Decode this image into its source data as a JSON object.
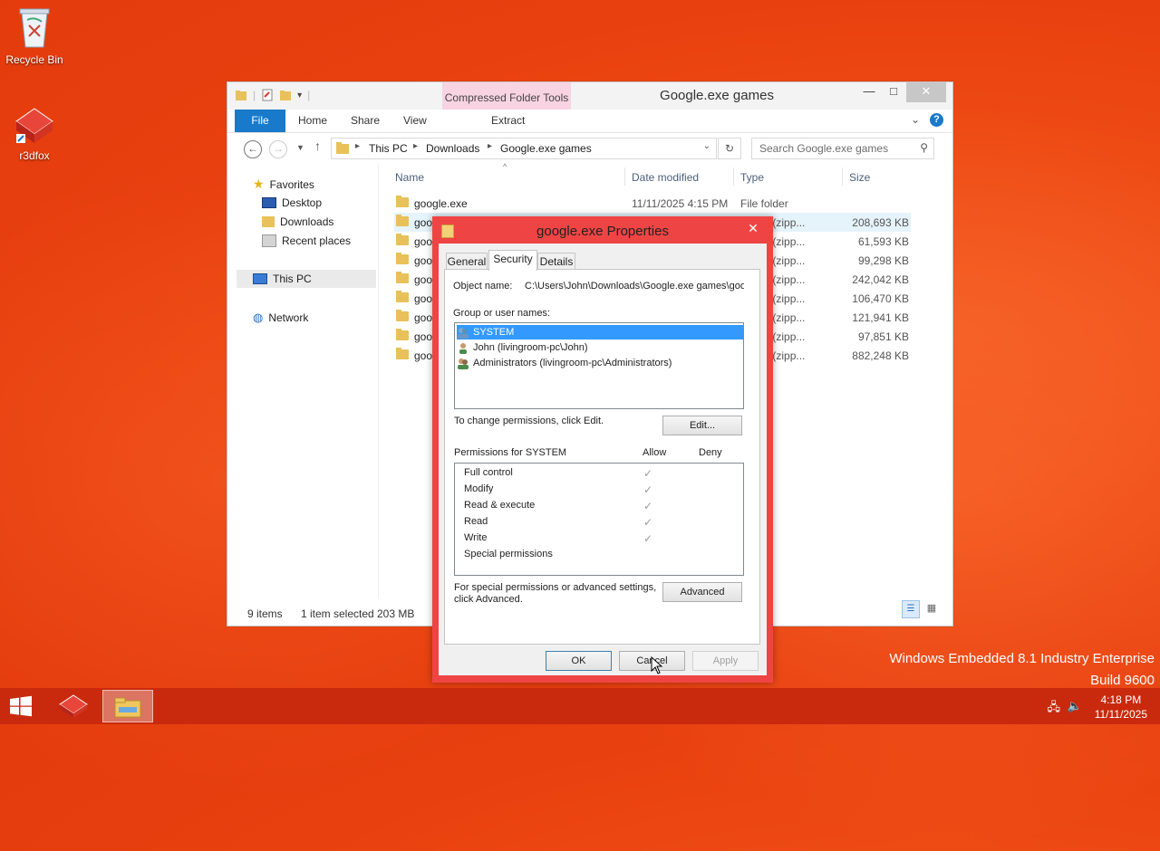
{
  "desktop": {
    "icons": [
      {
        "label": "Recycle Bin",
        "icon": "recycle-bin-icon"
      },
      {
        "label": "r3dfox",
        "icon": "r3dfox-icon"
      }
    ],
    "watermark": {
      "line1": "Windows Embedded 8.1 Industry Enterprise",
      "line2": "Build 9600"
    }
  },
  "explorer": {
    "title": "Google.exe games",
    "context_tab": "Compressed Folder Tools",
    "ribbon_tabs": {
      "file": "File",
      "home": "Home",
      "share": "Share",
      "view": "View",
      "extract": "Extract"
    },
    "help": "?",
    "address": {
      "crumbs": [
        "This PC",
        "Downloads",
        "Google.exe games"
      ]
    },
    "search": {
      "placeholder": "Search Google.exe games"
    },
    "nav_pane": {
      "favorites": "Favorites",
      "desktop": "Desktop",
      "downloads": "Downloads",
      "recent": "Recent places",
      "this_pc": "This PC",
      "network": "Network"
    },
    "columns": {
      "name": "Name",
      "date": "Date modified",
      "type": "Type",
      "size": "Size"
    },
    "files": [
      {
        "name": "google.exe",
        "date": "11/11/2025 4:15 PM",
        "type": "File folder",
        "size": ""
      },
      {
        "name": "goo",
        "date": "",
        "type": "essed (zipp...",
        "size": "208,693 KB"
      },
      {
        "name": "goo",
        "date": "",
        "type": "essed (zipp...",
        "size": "61,593 KB"
      },
      {
        "name": "goo",
        "date": "",
        "type": "essed (zipp...",
        "size": "99,298 KB"
      },
      {
        "name": "goo",
        "date": "",
        "type": "essed (zipp...",
        "size": "242,042 KB"
      },
      {
        "name": "goo",
        "date": "",
        "type": "essed (zipp...",
        "size": "106,470 KB"
      },
      {
        "name": "goo",
        "date": "",
        "type": "essed (zipp...",
        "size": "121,941 KB"
      },
      {
        "name": "goo",
        "date": "",
        "type": "essed (zipp...",
        "size": "97,851 KB"
      },
      {
        "name": "goo",
        "date": "",
        "type": "essed (zipp...",
        "size": "882,248 KB"
      }
    ],
    "status": {
      "items": "9 items",
      "selected": "1 item selected",
      "size": "203 MB"
    }
  },
  "dialog": {
    "title": "google.exe Properties",
    "tabs": {
      "general": "General",
      "security": "Security",
      "details": "Details"
    },
    "object_name_label": "Object name:",
    "object_name_value": "C:\\Users\\John\\Downloads\\Google.exe games\\goo",
    "group_label": "Group or user names:",
    "users": [
      {
        "name": "SYSTEM"
      },
      {
        "name": "John (livingroom-pc\\John)"
      },
      {
        "name": "Administrators (livingroom-pc\\Administrators)"
      }
    ],
    "change_text": "To change permissions, click Edit.",
    "edit_button": "Edit...",
    "permissions_label": "Permissions for SYSTEM",
    "allow_label": "Allow",
    "deny_label": "Deny",
    "permissions": [
      {
        "name": "Full control",
        "allow": true
      },
      {
        "name": "Modify",
        "allow": true
      },
      {
        "name": "Read & execute",
        "allow": true
      },
      {
        "name": "Read",
        "allow": true
      },
      {
        "name": "Write",
        "allow": true
      },
      {
        "name": "Special permissions",
        "allow": false
      }
    ],
    "advanced_text_1": "For special permissions or advanced settings,",
    "advanced_text_2": "click Advanced.",
    "advanced_button": "Advanced",
    "ok_button": "OK",
    "cancel_button": "Cancel",
    "apply_button": "Apply"
  },
  "taskbar": {
    "clock_time": "4:18 PM",
    "clock_date": "11/11/2025"
  }
}
